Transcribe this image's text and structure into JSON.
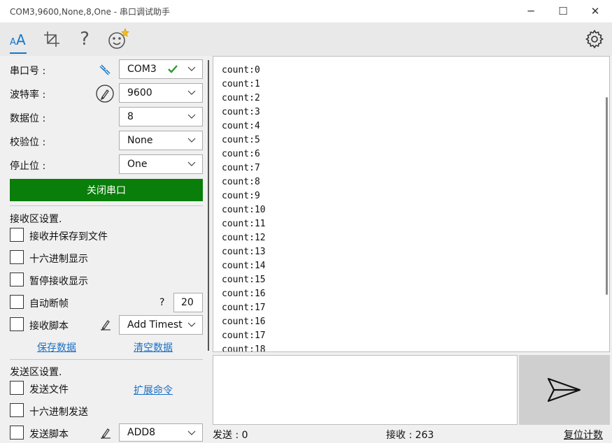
{
  "window": {
    "title": "COM3,9600,None,8,One - 串口调试助手",
    "minimize": "─",
    "maximize": "☐",
    "close": "✕"
  },
  "toolbar": {
    "font_icon": "font-size-icon",
    "crop_icon": "crop-icon",
    "help_label": "?",
    "emoji_icon": "smiley-icon",
    "settings_icon": "gear-icon"
  },
  "serial": {
    "port_label": "串口号 :",
    "port_value": "COM3",
    "baud_label": "波特率 :",
    "baud_value": "9600",
    "databits_label": "数据位 :",
    "databits_value": "8",
    "parity_label": "校验位 :",
    "parity_value": "None",
    "stopbits_label": "停止位 :",
    "stopbits_value": "One",
    "open_button": "关闭串口"
  },
  "receive_settings": {
    "header": "接收区设置.",
    "save_to_file": "接收并保存到文件",
    "hex_display": "十六进制显示",
    "pause_display": "暂停接收显示",
    "auto_frame": "自动断帧",
    "auto_frame_help": "?",
    "auto_frame_value": "20",
    "recv_script": "接收脚本",
    "recv_script_value": "Add Timest",
    "save_data": "保存数据",
    "clear_data": "清空数据"
  },
  "send_settings": {
    "header": "发送区设置.",
    "send_file": "发送文件",
    "extend_cmd": "扩展命令",
    "hex_send": "十六进制发送",
    "send_script": "发送脚本",
    "send_script_value": "ADD8"
  },
  "receive_lines": [
    "count:0",
    "count:1",
    "count:2",
    "count:3",
    "count:4",
    "count:5",
    "count:6",
    "count:7",
    "count:8",
    "count:9",
    "count:10",
    "count:11",
    "count:12",
    "count:13",
    "count:14",
    "count:15",
    "count:16",
    "count:17",
    "count:16",
    "count:17",
    "count:18"
  ],
  "status": {
    "sent_label": "发送 : 0",
    "recv_label": "接收 : 263",
    "reset_label": "复位计数"
  },
  "colors": {
    "accent": "#1677c8",
    "open_button": "#0a7e0a",
    "link": "#1a6fc4",
    "check": "#2a9a2a"
  }
}
